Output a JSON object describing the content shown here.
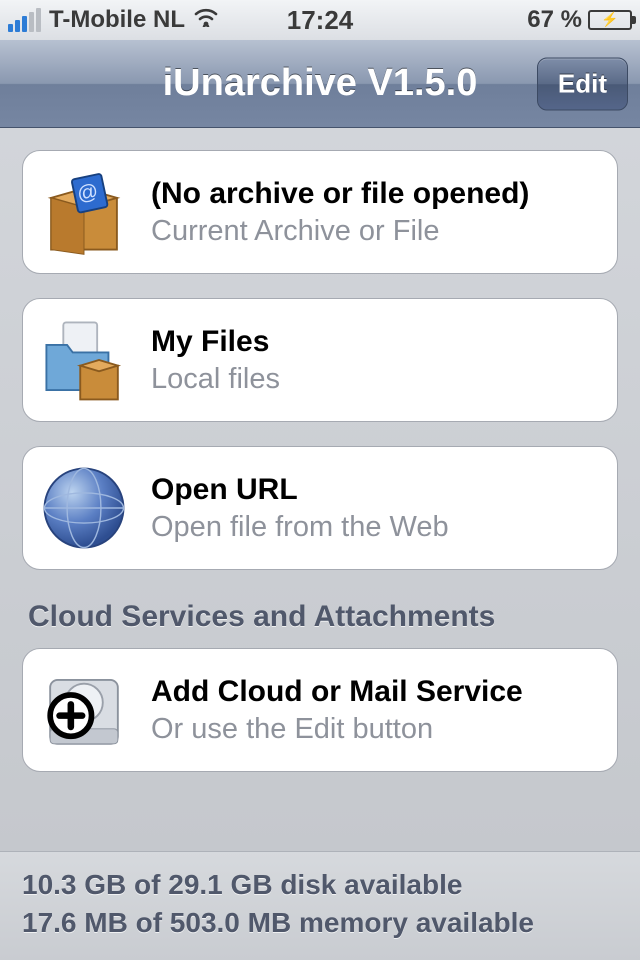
{
  "status": {
    "carrier": "T-Mobile NL",
    "time": "17:24",
    "battery_pct": "67 %"
  },
  "nav": {
    "title": "iUnarchive V1.5.0",
    "edit_label": "Edit"
  },
  "cells": [
    {
      "title": "(No archive or file opened)",
      "subtitle": "Current Archive or File",
      "icon": "archive-box-icon"
    },
    {
      "title": "My Files",
      "subtitle": "Local files",
      "icon": "folder-box-icon"
    },
    {
      "title": "Open URL",
      "subtitle": "Open file from the Web",
      "icon": "globe-icon"
    }
  ],
  "section_header": "Cloud Services and Attachments",
  "cloud_cell": {
    "title": "Add Cloud or Mail Service",
    "subtitle": "Or use the Edit button",
    "icon": "add-drive-icon"
  },
  "footer": {
    "disk": "10.3 GB of 29.1 GB disk available",
    "memory": "17.6 MB of 503.0 MB memory available"
  }
}
